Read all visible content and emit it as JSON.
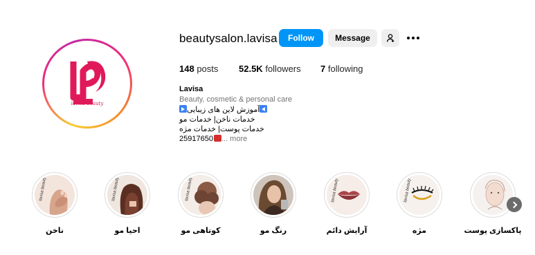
{
  "profile": {
    "username": "beautysalon.lavisa",
    "follow_label": "Follow",
    "message_label": "Message",
    "logo_caption": "lavisa beauty",
    "stats": {
      "posts_count": "148",
      "posts_label": "posts",
      "followers_count": "52.5K",
      "followers_label": "followers",
      "following_count": "7",
      "following_label": "following"
    },
    "bio": {
      "name": "Lavisa",
      "category": "Beauty, cosmetic & personal care",
      "line1": "آموزش لاین های زیبایی",
      "line2": "خدمات ناخن| خدمات مو",
      "line3": "خدمات پوست| خدمات مژه",
      "line4": "25917650",
      "more_label": "... more"
    }
  },
  "highlights": [
    {
      "label": "ناخن",
      "icon": "nail-hands"
    },
    {
      "label": "احیا مو",
      "icon": "hair-back"
    },
    {
      "label": "کوتاهی مو",
      "icon": "curly-hair"
    },
    {
      "label": "رنگ مو",
      "icon": "woman-portrait"
    },
    {
      "label": "آرایش دائم",
      "icon": "lips"
    },
    {
      "label": "مژه",
      "icon": "eyelash"
    },
    {
      "label": "پاکسازی پوست",
      "icon": "face-care"
    }
  ],
  "colors": {
    "accent": "#0095f6",
    "brand": "#e0195a",
    "secondary_button": "#efefef"
  }
}
